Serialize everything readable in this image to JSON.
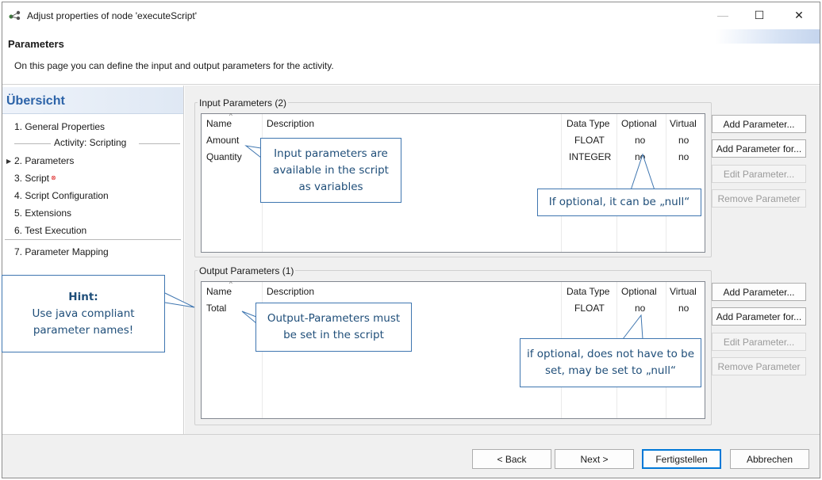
{
  "window": {
    "title": "Adjust properties of node 'executeScript'",
    "controls": {
      "minimize": "—",
      "maximize": "☐",
      "close": "✕"
    }
  },
  "header": {
    "title": "Parameters",
    "description": "On this page you can define the input and output parameters for the activity."
  },
  "nav": {
    "heading": "Übersicht",
    "items": [
      {
        "label": "1. General Properties"
      },
      {
        "label": "2. Parameters",
        "active": true
      },
      {
        "label": "3. Script",
        "error": true
      },
      {
        "label": "4. Script Configuration"
      },
      {
        "label": "5. Extensions"
      },
      {
        "label": "6. Test Execution"
      },
      {
        "label": "7. Parameter Mapping"
      }
    ],
    "group_label": "Activity: Scripting"
  },
  "input_params": {
    "legend": "Input Parameters (2)",
    "columns": [
      "Name",
      "Description",
      "Data Type",
      "Optional",
      "Virtual"
    ],
    "rows": [
      {
        "name": "Amount",
        "description": "",
        "type": "FLOAT",
        "optional": "no",
        "virtual": "no"
      },
      {
        "name": "Quantity",
        "description": "",
        "type": "INTEGER",
        "optional": "no",
        "virtual": "no"
      }
    ],
    "buttons": [
      {
        "label": "Add Parameter...",
        "enabled": true
      },
      {
        "label": "Add Parameter for...",
        "enabled": true
      },
      {
        "label": "Edit Parameter...",
        "enabled": false
      },
      {
        "label": "Remove Parameter",
        "enabled": false
      }
    ]
  },
  "output_params": {
    "legend": "Output Parameters (1)",
    "columns": [
      "Name",
      "Description",
      "Data Type",
      "Optional",
      "Virtual"
    ],
    "rows": [
      {
        "name": "Total",
        "description": "",
        "type": "FLOAT",
        "optional": "no",
        "virtual": "no"
      }
    ],
    "buttons": [
      {
        "label": "Add Parameter...",
        "enabled": true
      },
      {
        "label": "Add Parameter for...",
        "enabled": true
      },
      {
        "label": "Edit Parameter...",
        "enabled": false
      },
      {
        "label": "Remove Parameter",
        "enabled": false
      }
    ]
  },
  "callouts": {
    "input_vars": "Input parameters are available in the script as variables",
    "optional_null": "If optional, it can be „null“",
    "output_must_set": "Output-Parameters must be set in the script",
    "optional_output": "if optional, does not have to be set, may be set to „null“",
    "hint_title": "Hint:",
    "hint_body": "Use java compliant parameter names!"
  },
  "footer": {
    "back": "< Back",
    "next": "Next >",
    "finish": "Fertigstellen",
    "cancel": "Abbrechen"
  },
  "colors": {
    "nav_heading": "#2c63a8",
    "callout_text": "#1f4e79",
    "callout_border": "#3f76b0"
  }
}
